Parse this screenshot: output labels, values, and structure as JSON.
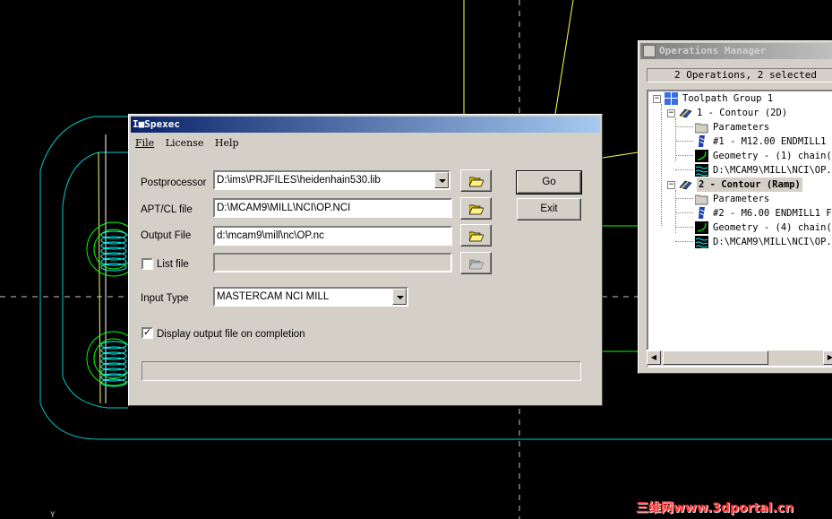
{
  "background": {
    "label": "CAD viewport with toolpath geometry",
    "colors": {
      "base": "#000000",
      "geometry": "#00ffff",
      "path": "#ffff00",
      "tool": "#00ff00"
    }
  },
  "ops_manager": {
    "title": "Operations Manager",
    "status": "2 Operations, 2 selected",
    "tree": {
      "group": "Toolpath Group 1",
      "op1": {
        "label": "1 - Contour (2D)",
        "parameters": "Parameters",
        "tool": "#1 - M12.00 ENDMILL1",
        "geometry": "Geometry - (1) chain(",
        "nci": "D:\\MCAM9\\MILL\\NCI\\OP."
      },
      "op2": {
        "label": "2 - Contour (Ramp)",
        "parameters": "Parameters",
        "tool": "#2 - M6.00 ENDMILL1 F",
        "geometry": "Geometry - (4) chain(",
        "nci": "D:\\MCAM9\\MILL\\NCI\\OP."
      }
    }
  },
  "dialog": {
    "title": "I■Spexec",
    "menu": {
      "file": "File",
      "license": "License",
      "help": "Help"
    },
    "postprocessor": {
      "label": "Postprocessor",
      "value": "D:\\ims\\PRJFILES\\heidenhain530.lib"
    },
    "apt_cl": {
      "label": "APT/CL file",
      "value": "D:\\MCAM9\\MILL\\NCI\\OP.NCI"
    },
    "output": {
      "label": "Output File",
      "value": "d:\\mcam9\\mill\\nc\\OP.nc"
    },
    "list_file": {
      "label": "List file",
      "checked": false,
      "value": ""
    },
    "input_type": {
      "label": "Input Type",
      "value": "MASTERCAM NCI MILL"
    },
    "display_output": {
      "label": "Display output file on completion",
      "checked": true
    },
    "buttons": {
      "go": "Go",
      "exit": "Exit"
    },
    "progress": 0
  },
  "watermark": "三维网www.3dportal.cn"
}
